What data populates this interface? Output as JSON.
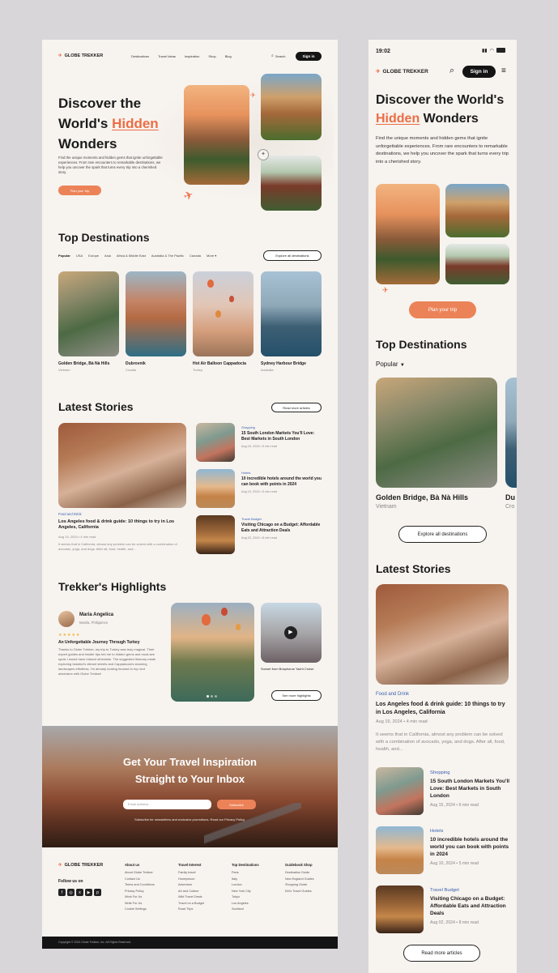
{
  "desktop": {
    "logo": "GLOBE TREKKER",
    "nav": [
      "Destinations",
      "Travel Ideas",
      "Inspiration",
      "Shop",
      "Blog"
    ],
    "search_label": "Search",
    "signin": "Sign in",
    "hero": {
      "title_1": "Discover the",
      "title_2a": "World's ",
      "title_2b": "Hidden",
      "title_3": "Wonders",
      "body": "Find the unique moments and hidden gems that ignite unforgettable experiences. From rare encounters to remarkable destinations, we help you uncover the spark that turns every trip into a cherished story.",
      "cta": "Plan your trip"
    },
    "top_dest": {
      "title": "Top Destinations",
      "filters": [
        "Popular",
        "USA",
        "Europe",
        "Asia",
        "Africa & Middle East",
        "Australia & The Pacific",
        "Canada",
        "More"
      ],
      "explore": "Explore all destinations",
      "cards": [
        {
          "name": "Golden Bridge, Bà Nà Hills",
          "country": "Vietnam"
        },
        {
          "name": "Dubrovnik",
          "country": "Croatia"
        },
        {
          "name": "Hot Air Balloon Cappadocia",
          "country": "Turkey"
        },
        {
          "name": "Sydney Harbour Bridge",
          "country": "Australia"
        }
      ]
    },
    "stories": {
      "title": "Latest Stories",
      "read_more": "Read more articles",
      "main": {
        "tag": "Food and Drink",
        "title": "Los Angeles food & drink guide: 10 things to try in Los Angeles, California",
        "meta": "Aug 19, 2024 • 4 min read",
        "body": "It seems that in California, almost any problem can be solved with a combination of avocado, yoga, and dogs. After all, food, health, and..."
      },
      "side": [
        {
          "tag": "Shopping",
          "title": "15 South London Markets You'll Love: Best Markets in South London",
          "meta": "Aug 15, 2024 • 6 min read"
        },
        {
          "tag": "Hotels",
          "title": "10 incredible hotels around the world you can book with points in 2024",
          "meta": "Aug 10, 2024 • 5 min read"
        },
        {
          "tag": "Travel Budget",
          "title": "Visiting Chicago on a Budget: Affordable Eats and Attraction Deals",
          "meta": "Aug 02, 2024 • 8 min read"
        }
      ]
    },
    "highlights": {
      "title": "Trekker's Highlights",
      "user_name": "Maria Angelica",
      "user_loc": "Manila, Philippines",
      "stars": "★★★★★",
      "review_title": "An Unforgettable Journey Through Turkey",
      "review_body": "Thanks to Globe Trekker, my trip to Turkey was truly magical. Their expert guides and insider tips led me to hidden gems and must-see spots I would have missed otherwise. The suggested itinerary made exploring Istanbul's vibrant streets and Cappadocia's stunning landscapes effortless. I'm already looking forward to my next adventure with Globe Trekker!",
      "video_caption": "Sunset from Bosphorus Yacht Cruise",
      "see_more": "See more highlights"
    },
    "newsletter": {
      "title_1": "Get Your Travel Inspiration",
      "title_2": "Straight to Your Inbox",
      "placeholder": "Email address",
      "subscribe": "Subscribe",
      "note": "Subscribe for newsletters and exclusive promotions. Read our Privacy Policy."
    },
    "footer": {
      "follow": "Follow us on",
      "cols": [
        {
          "head": "About us",
          "items": [
            "About Globe Trekker",
            "Contact Us",
            "Terms and Conditions",
            "Privacy Policy",
            "Work For Us",
            "Write For Us",
            "Cookie Settings"
          ]
        },
        {
          "head": "Travel Interest",
          "items": [
            "Family travel",
            "Honeymoon",
            "Adventure",
            "Art and Culture",
            "Wild Travel Deals",
            "Travel on a Budget",
            "Road Trips"
          ]
        },
        {
          "head": "Top Destinations",
          "items": [
            "Paris",
            "Italy",
            "London",
            "New York City",
            "Tokyo",
            "Los Angeles",
            "Scotland"
          ]
        },
        {
          "head": "Guidebook Shop",
          "items": [
            "Destination Guide",
            "New England Guides",
            "Shopping Guide",
            "Kid's Travel Guides"
          ]
        }
      ],
      "copyright": "Copyright © 2024 Globe Trekker, Inc. All Rights Reserved."
    }
  },
  "mobile": {
    "time": "19:02",
    "logo": "GLOBE TREKKER",
    "signin": "Sign in",
    "hero_title_1": "Discover the World's",
    "hero_title_2a": "Hidden",
    "hero_title_2b": " Wonders",
    "hero_body": "Find the unique moments and hidden gems that ignite unforgettable experiences. From rare encounters to remarkable destinations, we help you uncover the spark that turns every trip into a cherished story.",
    "cta": "Plan your trip",
    "top_dest_title": "Top Destinations",
    "filter": "Popular",
    "card_name": "Golden Bridge, Bà Nà Hills",
    "card_country": "Vietnam",
    "peek_name": "Du",
    "peek_country": "Cro",
    "explore": "Explore all destinations",
    "stories_title": "Latest Stories",
    "main_tag": "Food and Drink",
    "main_title": "Los Angeles food & drink guide: 10 things to try in Los Angeles, California",
    "main_meta": "Aug 19, 2024 • 4 min read",
    "main_body": "It seems that in California, almost any problem can be solved with a combination of avocado, yoga, and dogs. After all, food, health, and...",
    "side": [
      {
        "tag": "Shopping",
        "title": "15 South London Markets You'll Love: Best Markets in South London",
        "meta": "Aug 15, 2024 • 6 min read"
      },
      {
        "tag": "Hotels",
        "title": "10 incredible hotels around the world you can book with points in 2024",
        "meta": "Aug 10, 2024 • 5 min read"
      },
      {
        "tag": "Travel Budget",
        "title": "Visiting Chicago on a Budget: Affordable Eats and Attraction Deals",
        "meta": "Aug 02, 2024 • 8 min read"
      }
    ],
    "read_more": "Read more articles"
  }
}
